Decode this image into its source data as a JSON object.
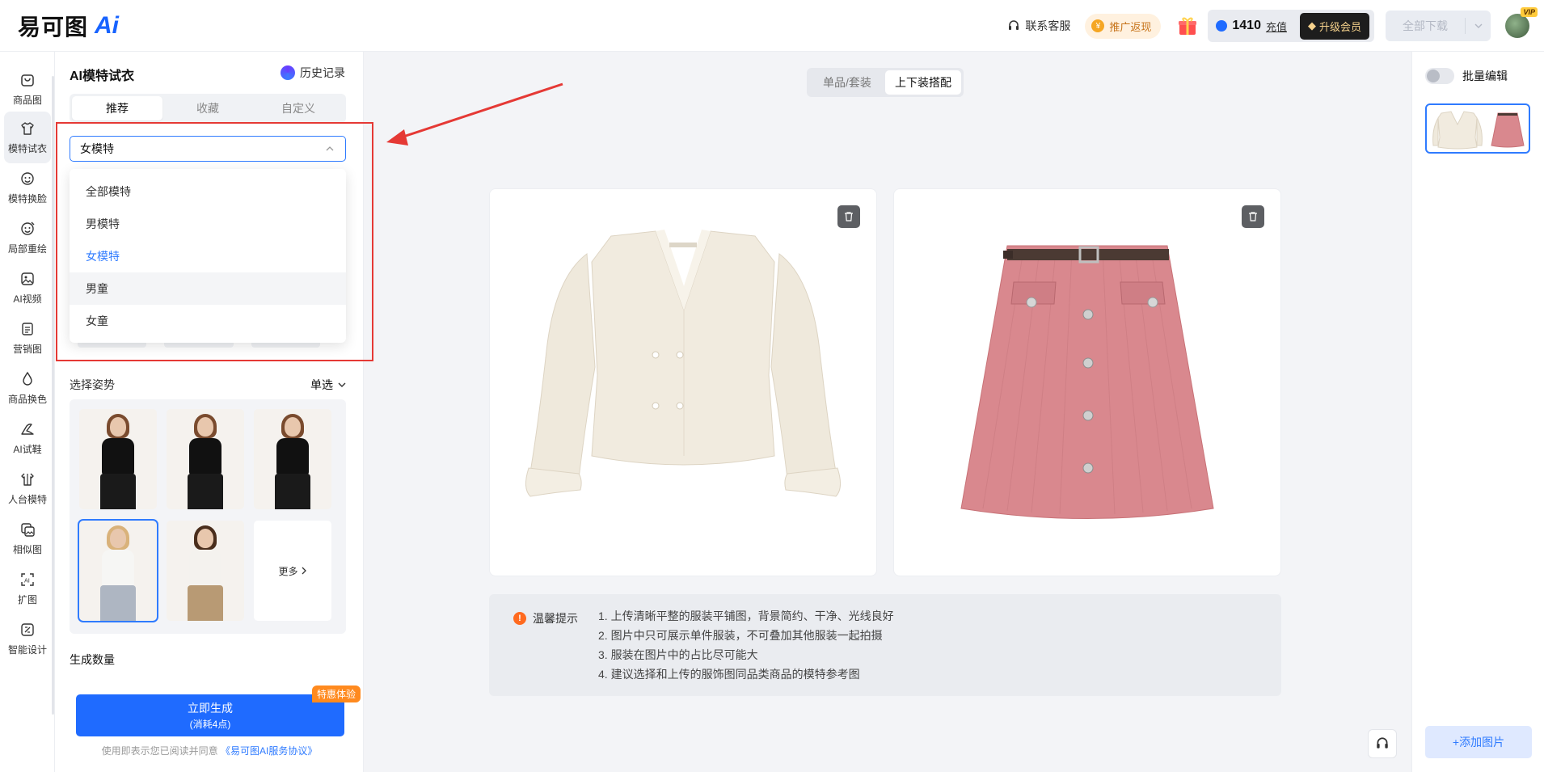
{
  "header": {
    "logo_text": "易可图",
    "logo_ai": "Ai",
    "service": "联系客服",
    "promo": "推广返现",
    "points": "1410",
    "recharge": "充值",
    "upgrade": "升级会员",
    "download_all": "全部下载",
    "vip_tag": "VIP"
  },
  "nav": {
    "items": [
      {
        "label": "商品图",
        "icon": "product-image-icon"
      },
      {
        "label": "模特试衣",
        "icon": "tshirt-icon",
        "active": true
      },
      {
        "label": "模特换脸",
        "icon": "face-swap-icon"
      },
      {
        "label": "局部重绘",
        "icon": "face-redraw-icon"
      },
      {
        "label": "AI视频",
        "icon": "video-icon"
      },
      {
        "label": "营销图",
        "icon": "marketing-icon"
      },
      {
        "label": "商品换色",
        "icon": "color-drop-icon"
      },
      {
        "label": "AI试鞋",
        "icon": "shoe-icon"
      },
      {
        "label": "人台模特",
        "icon": "mannequin-icon"
      },
      {
        "label": "相似图",
        "icon": "similar-image-icon"
      },
      {
        "label": "扩图",
        "icon": "expand-ai-icon"
      },
      {
        "label": "智能设计",
        "icon": "smart-design-icon"
      }
    ]
  },
  "panel": {
    "title": "AI模特试衣",
    "history": "历史记录",
    "tabs": [
      "推荐",
      "收藏",
      "自定义"
    ],
    "model_select": {
      "value": "女模特",
      "options": [
        "全部模特",
        "男模特",
        "女模特",
        "男童",
        "女童"
      ]
    },
    "pose_title": "选择姿势",
    "pose_mode": "单选",
    "more": "更多",
    "count_title": "生成数量",
    "generate": "立即生成",
    "generate_cost": "(消耗4点)",
    "promo_tag": "特惠体验",
    "agree_prefix": "使用即表示您已阅读并同意",
    "agree_link": "《易可图AI服务协议》"
  },
  "canvas": {
    "modes": [
      "单品/套装",
      "上下装搭配"
    ],
    "active_mode": "上下装搭配",
    "tips_title": "温馨提示",
    "tips": [
      "1. 上传清晰平整的服装平铺图，背景简约、干净、光线良好",
      "2. 图片中只可展示单件服装，不可叠加其他服装一起拍摄",
      "3. 服装在图片中的占比尽可能大",
      "4. 建议选择和上传的服饰图同品类商品的模特参考图"
    ]
  },
  "right": {
    "batch_edit": "批量编辑",
    "add_image": "+添加图片"
  },
  "colors": {
    "primary": "#1f6bff",
    "annotation": "#e53935",
    "promo": "#ff8a1f"
  }
}
